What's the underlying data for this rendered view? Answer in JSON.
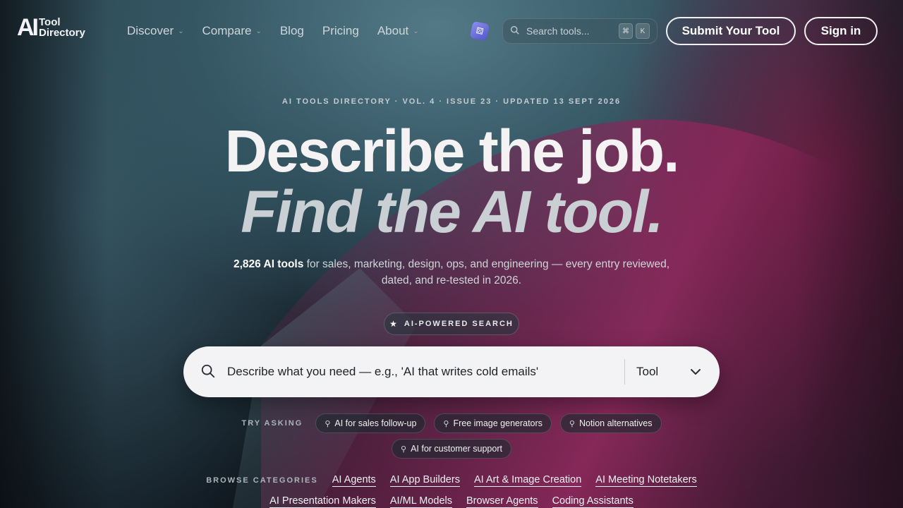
{
  "logo": {
    "mark": "AI",
    "line1": "Tool",
    "line2": "Directory"
  },
  "nav": {
    "items": [
      {
        "label": "Discover",
        "dropdown": true
      },
      {
        "label": "Compare",
        "dropdown": true
      },
      {
        "label": "Blog",
        "dropdown": false
      },
      {
        "label": "Pricing",
        "dropdown": false
      },
      {
        "label": "About",
        "dropdown": true
      }
    ],
    "search_placeholder": "Search tools...",
    "kbd1": "⌘",
    "kbd2": "K",
    "submit_label": "Submit Your Tool",
    "signin_label": "Sign in"
  },
  "hero": {
    "eyebrow": "AI TOOLS DIRECTORY · VOL. 4 · ISSUE 23 · UPDATED 13 SEPT 2026",
    "headline1": "Describe the job.",
    "headline2": "Find the AI tool.",
    "lede_count": "2,826 AI tools",
    "lede_rest": " for sales, marketing, design, ops, and engineering — every entry reviewed, dated, and re-tested in 2026.",
    "pill": "AI-POWERED SEARCH"
  },
  "search": {
    "placeholder": "Describe what you need — e.g., 'AI that writes cold emails'",
    "type_value": "Tool"
  },
  "try_asking": {
    "label": "TRY ASKING",
    "chips": [
      "AI for sales follow-up",
      "Free image generators",
      "Notion alternatives",
      "AI for customer support"
    ]
  },
  "categories": {
    "label": "BROWSE CATEGORIES",
    "row1": [
      "AI Agents",
      "AI App Builders",
      "AI Art & Image Creation",
      "AI Meeting Notetakers"
    ],
    "row2": [
      "AI Presentation Makers",
      "AI/ML Models",
      "Browser Agents",
      "Coding Assistants"
    ]
  },
  "colors": {
    "accent_wave": "#8a1f55",
    "bg_dark": "#17232b",
    "search_bg": "#f3f3f5"
  }
}
